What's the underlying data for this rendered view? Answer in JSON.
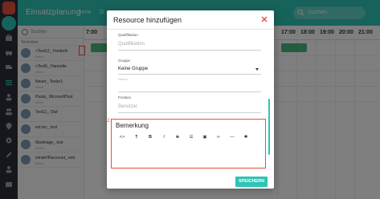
{
  "app": {
    "title": "Einsatzplanung",
    "tabs": [
      "Serie",
      "D"
    ],
    "search_placeholder": "Suchen..."
  },
  "resources": {
    "filter": "Suchen",
    "group_label": "Techniker",
    "items": [
      {
        "name": "<Test12_ Frederik",
        "sub": "Meldt"
      },
      {
        "name": "<Test5_ Hannelie",
        "sub": "Meldt"
      },
      {
        "name": "Neuer_ Tester1",
        "sub": "Meldt"
      },
      {
        "name": "Paula_ MicrosoftTest",
        "sub": "Meldt"
      },
      {
        "name": "Test11_ Olaf",
        "sub": ""
      },
      {
        "name": "ext.tec_ test",
        "sub": ""
      },
      {
        "name": "Martinage_ test",
        "sub": "Meldt"
      },
      {
        "name": "simahl!Raccount_ extr",
        "sub": "Meldt"
      }
    ]
  },
  "calendar": {
    "hours": [
      "7:00",
      "17:00",
      "18:00",
      "19:00",
      "20:00",
      "21:00"
    ]
  },
  "modal": {
    "title": "Resource hinzufügen",
    "qualifikation": {
      "label": "Qualifikation",
      "placeholder": "Qualifikation"
    },
    "gruppe": {
      "label": "Gruppe",
      "value": "Keine Gruppe",
      "helper": "Neben"
    },
    "position": {
      "label": "Position",
      "placeholder": "Benutzer"
    },
    "step_number": "2.",
    "bemerkung": {
      "title": "Bemerkung"
    },
    "toolbar": [
      {
        "icon": "code-icon",
        "glyph": "<>"
      },
      {
        "icon": "paragraph-icon",
        "glyph": "¶"
      },
      {
        "icon": "bold-icon",
        "glyph": "B"
      },
      {
        "icon": "italic-icon",
        "glyph": "I"
      },
      {
        "icon": "strikethrough-icon",
        "glyph": "S"
      },
      {
        "icon": "list-icon",
        "glyph": "☰"
      },
      {
        "icon": "image-icon",
        "glyph": "▣"
      },
      {
        "icon": "link-icon",
        "glyph": "∞"
      },
      {
        "icon": "horizontal-rule-icon",
        "glyph": "—"
      },
      {
        "icon": "settings-icon",
        "glyph": "✱"
      }
    ],
    "save_label": "SPEICHERN"
  },
  "colors": {
    "accent": "#2ec4b6",
    "danger": "#e8503c",
    "rail": "#2b2f3b",
    "event": "#4cb87c"
  }
}
